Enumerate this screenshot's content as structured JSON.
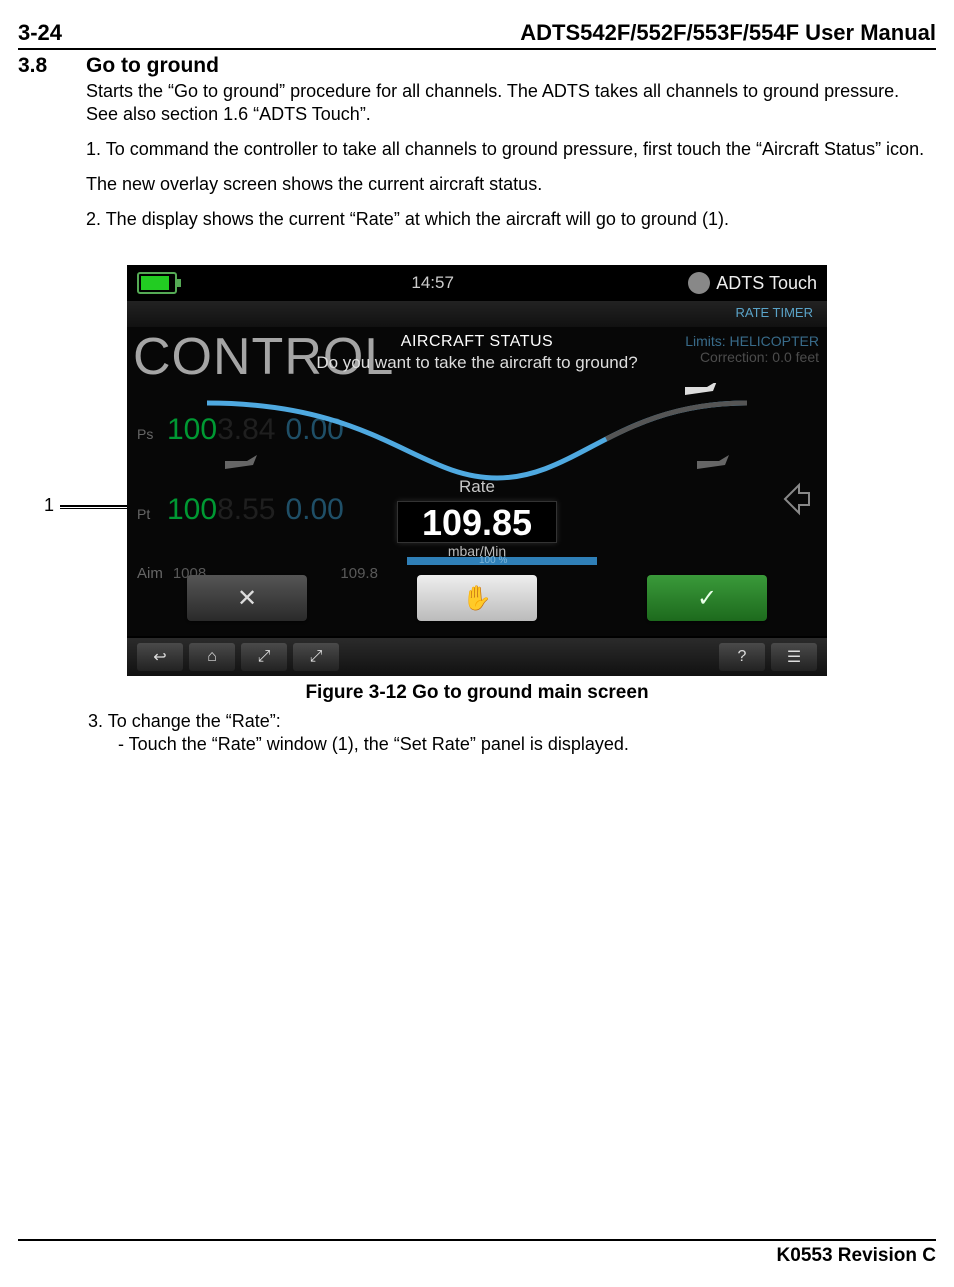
{
  "header": {
    "pageNum": "3-24",
    "manualTitle": "ADTS542F/552F/553F/554F User Manual"
  },
  "section": {
    "number": "3.8",
    "title": "Go to ground",
    "p1": "Starts the “Go to ground” procedure for all channels. The ADTS takes all channels to ground pressure. See also section 1.6 “ADTS Touch”.",
    "p2": "1. To command the controller to take all channels to ground pressure, first touch the “Aircraft Status” icon.",
    "p3": "The new overlay screen shows the current aircraft status.",
    "p4": "2. The display shows the current “Rate” at which the aircraft will go to ground (1).",
    "p5": "3. To change the “Rate”:",
    "p5a": "- Touch the “Rate” window (1), the “Set Rate” panel is displayed."
  },
  "callout": {
    "label": "1"
  },
  "device": {
    "clock": "14:57",
    "brand": "ADTS Touch",
    "rateTimer": "RATE TIMER",
    "limits": "Limits: HELICOPTER",
    "correction": "Correction: 0.0 feet",
    "controlWord": "CONTROL",
    "psLabel": "Ps",
    "ptLabel": "Pt",
    "aimLabel": "Aim",
    "psGreen": "100",
    "psDim": "3.84",
    "ptGreen": "100",
    "ptDim": "8.55",
    "zero1": "0.00",
    "zero2": "0.00",
    "aimVal1": "1008.",
    "aimVal2": "109.8",
    "dialog": {
      "title": "AIRCRAFT STATUS",
      "question": "Do you want to take the aircraft to ground?",
      "rateLabel": "Rate",
      "rateValue": "109.85",
      "rateUnit": "mbar/Min",
      "progress": "100 %",
      "cancel": "✕",
      "hold": "✋",
      "confirm": "✓"
    },
    "nav": {
      "back": "↩",
      "home": "⌂",
      "ex1": "⤢",
      "ex2": "⤢",
      "help": "?",
      "menu": "☰"
    }
  },
  "figure": {
    "caption": "Figure 3-12 Go to ground main screen"
  },
  "footer": {
    "revision": "K0553 Revision C"
  }
}
